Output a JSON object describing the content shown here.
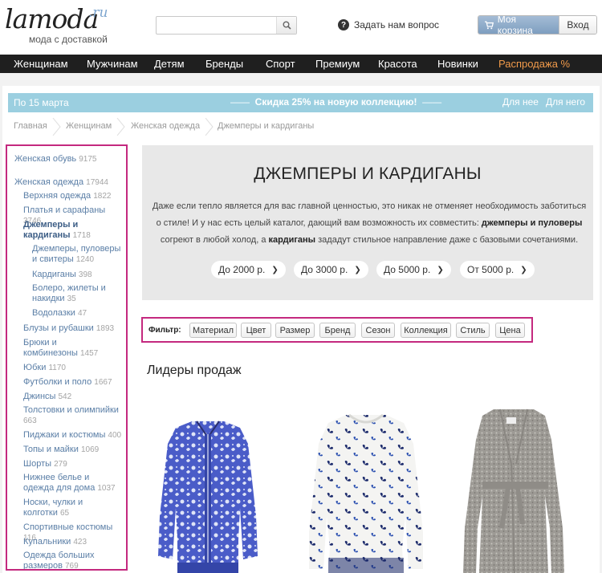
{
  "header": {
    "logo_text": "lamoda",
    "logo_suffix": ".ru",
    "tagline": "мода с доставкой",
    "search_placeholder": "",
    "ask_label": "Задать нам вопрос",
    "cart_label": "Моя корзина",
    "login_label": "Вход"
  },
  "nav": {
    "items": [
      {
        "label": "Женщинам"
      },
      {
        "label": "Мужчинам"
      },
      {
        "label": "Детям"
      },
      {
        "label": "Бренды"
      },
      {
        "label": "Спорт"
      },
      {
        "label": "Премиум"
      },
      {
        "label": "Красота"
      },
      {
        "label": "Новинки"
      },
      {
        "label": "Распродажа %",
        "color": "#f19a4a"
      }
    ]
  },
  "promo": {
    "left": "По 15 марта",
    "center": "Скидка 25% на новую коллекцию!",
    "right_women": "Для нее",
    "right_men": "Для него"
  },
  "breadcrumb": [
    "Главная",
    "Женщинам",
    "Женская одежда",
    "Джемперы и кардиганы"
  ],
  "sidebar": {
    "items": [
      {
        "label": "Женская обувь",
        "count": "9175"
      },
      {
        "label": "Женская одежда",
        "count": "17944"
      },
      {
        "label": "Верхняя одежда",
        "count": "1822"
      },
      {
        "label": "Платья и сарафаны",
        "count": "3746"
      },
      {
        "label": "Джемперы и кардиганы",
        "count": "1718"
      },
      {
        "label": "Джемперы, пуловеры и свитеры",
        "count": "1240"
      },
      {
        "label": "Кардиганы",
        "count": "398"
      },
      {
        "label": "Болеро, жилеты и накидки",
        "count": "35"
      },
      {
        "label": "Водолазки",
        "count": "47"
      },
      {
        "label": "Блузы и рубашки",
        "count": "1893"
      },
      {
        "label": "Брюки и комбинезоны",
        "count": "1457"
      },
      {
        "label": "Юбки",
        "count": "1170"
      },
      {
        "label": "Футболки и поло",
        "count": "1667"
      },
      {
        "label": "Джинсы",
        "count": "542"
      },
      {
        "label": "Толстовки и олимпийки",
        "count": "663"
      },
      {
        "label": "Пиджаки и костюмы",
        "count": "400"
      },
      {
        "label": "Топы и майки",
        "count": "1069"
      },
      {
        "label": "Шорты",
        "count": "279"
      },
      {
        "label": "Нижнее белье и одежда для дома",
        "count": "1037"
      },
      {
        "label": "Носки, чулки и колготки",
        "count": "65"
      },
      {
        "label": "Спортивные костюмы",
        "count": "116"
      },
      {
        "label": "Купальники",
        "count": "423"
      },
      {
        "label": "Одежда больших размеров",
        "count": "769"
      }
    ]
  },
  "hero": {
    "title": "ДЖЕМПЕРЫ И КАРДИГАНЫ",
    "desc_1": "Даже если тепло является для вас главной ценностью, это никак не отменяет необходимость заботиться о стиле! И у нас есть целый каталог, дающий вам возможность их совместить: ",
    "desc_b1": "джемперы и пуловеры",
    "desc_2": " согреют в любой холод, а ",
    "desc_b2": "кардиганы",
    "desc_3": " зададут стильное направление даже с базовыми сочетаниями.",
    "price_buttons": [
      "До 2000 р.",
      "До 3000 р.",
      "До 5000 р.",
      "От 5000 р."
    ]
  },
  "filter": {
    "label": "Фильтр:",
    "buttons": [
      "Материал",
      "Цвет",
      "Размер",
      "Бренд",
      "Сезон",
      "Коллекция",
      "Стиль",
      "Цена"
    ]
  },
  "bestsellers": {
    "title": "Лидеры продаж"
  },
  "colors": {
    "accent_magenta": "#c4297f",
    "promo_blue": "#9bcfe0",
    "nav_bg": "#1f1f1f",
    "sale_orange": "#f19a4a",
    "link_blue": "#5a7ea6"
  }
}
